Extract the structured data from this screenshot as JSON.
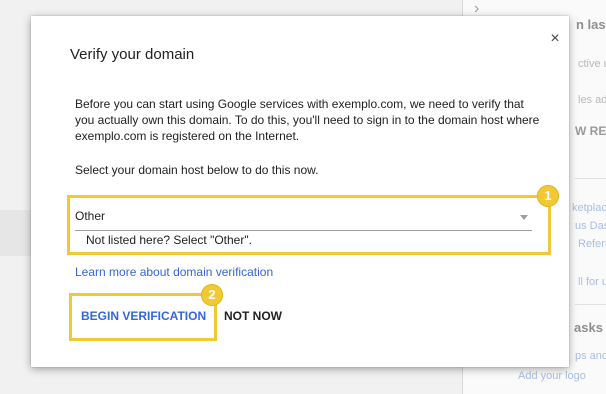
{
  "background": {
    "items": [
      {
        "id": "bg-1",
        "text": "n last"
      },
      {
        "id": "bg-2",
        "text": "ctive u"
      },
      {
        "id": "bg-3",
        "text": "les ad"
      },
      {
        "id": "bg-4",
        "text": "W REI"
      },
      {
        "id": "bg-5",
        "text": "ketplac"
      },
      {
        "id": "bg-6",
        "text": "us Das"
      },
      {
        "id": "bg-7",
        "text": "Referr"
      },
      {
        "id": "bg-8",
        "text": "ll for u"
      },
      {
        "id": "bg-9",
        "text": "asks"
      },
      {
        "id": "bg-10",
        "text": "ps and"
      },
      {
        "id": "bg-11",
        "text": "Add your logo"
      }
    ]
  },
  "dialog": {
    "title": "Verify your domain",
    "close_label": "×",
    "body": "Before you can start using Google services with exemplo.com, we need to verify that you actually own this domain. To do this, you'll need to sign in to the domain host where exemplo.com is registered on the Internet.",
    "instruction": "Select your domain host below to do this now.",
    "select": {
      "value": "Other",
      "helper": "Not listed here? Select \"Other\"."
    },
    "learn_more": "Learn more about domain verification",
    "buttons": {
      "begin": "BEGIN VERIFICATION",
      "not_now": "NOT NOW"
    }
  },
  "callouts": [
    {
      "number": "1"
    },
    {
      "number": "2"
    }
  ],
  "colors": {
    "accent": "#3367d6",
    "callout": "#f2c935",
    "text": "#212121"
  }
}
